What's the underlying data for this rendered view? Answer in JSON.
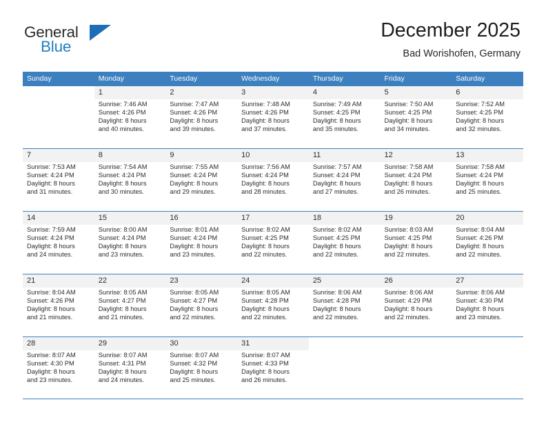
{
  "brand": {
    "name_part1": "General",
    "name_part2": "Blue",
    "logo_icon": "triangle-icon",
    "accent_color": "#1c6fb4"
  },
  "header": {
    "title": "December 2025",
    "subtitle": "Bad Worishofen, Germany"
  },
  "theme": {
    "header_row_color": "#3d80bf",
    "day_band_color": "#f2f2f2",
    "text_color": "#2b2b2b"
  },
  "weekday_headers": [
    "Sunday",
    "Monday",
    "Tuesday",
    "Wednesday",
    "Thursday",
    "Friday",
    "Saturday"
  ],
  "weeks": [
    [
      {
        "day": "",
        "info": "",
        "blank": true
      },
      {
        "day": "1",
        "info": "Sunrise: 7:46 AM\nSunset: 4:26 PM\nDaylight: 8 hours\nand 40 minutes."
      },
      {
        "day": "2",
        "info": "Sunrise: 7:47 AM\nSunset: 4:26 PM\nDaylight: 8 hours\nand 39 minutes."
      },
      {
        "day": "3",
        "info": "Sunrise: 7:48 AM\nSunset: 4:26 PM\nDaylight: 8 hours\nand 37 minutes."
      },
      {
        "day": "4",
        "info": "Sunrise: 7:49 AM\nSunset: 4:25 PM\nDaylight: 8 hours\nand 35 minutes."
      },
      {
        "day": "5",
        "info": "Sunrise: 7:50 AM\nSunset: 4:25 PM\nDaylight: 8 hours\nand 34 minutes."
      },
      {
        "day": "6",
        "info": "Sunrise: 7:52 AM\nSunset: 4:25 PM\nDaylight: 8 hours\nand 32 minutes."
      }
    ],
    [
      {
        "day": "7",
        "info": "Sunrise: 7:53 AM\nSunset: 4:24 PM\nDaylight: 8 hours\nand 31 minutes."
      },
      {
        "day": "8",
        "info": "Sunrise: 7:54 AM\nSunset: 4:24 PM\nDaylight: 8 hours\nand 30 minutes."
      },
      {
        "day": "9",
        "info": "Sunrise: 7:55 AM\nSunset: 4:24 PM\nDaylight: 8 hours\nand 29 minutes."
      },
      {
        "day": "10",
        "info": "Sunrise: 7:56 AM\nSunset: 4:24 PM\nDaylight: 8 hours\nand 28 minutes."
      },
      {
        "day": "11",
        "info": "Sunrise: 7:57 AM\nSunset: 4:24 PM\nDaylight: 8 hours\nand 27 minutes."
      },
      {
        "day": "12",
        "info": "Sunrise: 7:58 AM\nSunset: 4:24 PM\nDaylight: 8 hours\nand 26 minutes."
      },
      {
        "day": "13",
        "info": "Sunrise: 7:58 AM\nSunset: 4:24 PM\nDaylight: 8 hours\nand 25 minutes."
      }
    ],
    [
      {
        "day": "14",
        "info": "Sunrise: 7:59 AM\nSunset: 4:24 PM\nDaylight: 8 hours\nand 24 minutes."
      },
      {
        "day": "15",
        "info": "Sunrise: 8:00 AM\nSunset: 4:24 PM\nDaylight: 8 hours\nand 23 minutes."
      },
      {
        "day": "16",
        "info": "Sunrise: 8:01 AM\nSunset: 4:24 PM\nDaylight: 8 hours\nand 23 minutes."
      },
      {
        "day": "17",
        "info": "Sunrise: 8:02 AM\nSunset: 4:25 PM\nDaylight: 8 hours\nand 22 minutes."
      },
      {
        "day": "18",
        "info": "Sunrise: 8:02 AM\nSunset: 4:25 PM\nDaylight: 8 hours\nand 22 minutes."
      },
      {
        "day": "19",
        "info": "Sunrise: 8:03 AM\nSunset: 4:25 PM\nDaylight: 8 hours\nand 22 minutes."
      },
      {
        "day": "20",
        "info": "Sunrise: 8:04 AM\nSunset: 4:26 PM\nDaylight: 8 hours\nand 22 minutes."
      }
    ],
    [
      {
        "day": "21",
        "info": "Sunrise: 8:04 AM\nSunset: 4:26 PM\nDaylight: 8 hours\nand 21 minutes."
      },
      {
        "day": "22",
        "info": "Sunrise: 8:05 AM\nSunset: 4:27 PM\nDaylight: 8 hours\nand 21 minutes."
      },
      {
        "day": "23",
        "info": "Sunrise: 8:05 AM\nSunset: 4:27 PM\nDaylight: 8 hours\nand 22 minutes."
      },
      {
        "day": "24",
        "info": "Sunrise: 8:05 AM\nSunset: 4:28 PM\nDaylight: 8 hours\nand 22 minutes."
      },
      {
        "day": "25",
        "info": "Sunrise: 8:06 AM\nSunset: 4:28 PM\nDaylight: 8 hours\nand 22 minutes."
      },
      {
        "day": "26",
        "info": "Sunrise: 8:06 AM\nSunset: 4:29 PM\nDaylight: 8 hours\nand 22 minutes."
      },
      {
        "day": "27",
        "info": "Sunrise: 8:06 AM\nSunset: 4:30 PM\nDaylight: 8 hours\nand 23 minutes."
      }
    ],
    [
      {
        "day": "28",
        "info": "Sunrise: 8:07 AM\nSunset: 4:30 PM\nDaylight: 8 hours\nand 23 minutes."
      },
      {
        "day": "29",
        "info": "Sunrise: 8:07 AM\nSunset: 4:31 PM\nDaylight: 8 hours\nand 24 minutes."
      },
      {
        "day": "30",
        "info": "Sunrise: 8:07 AM\nSunset: 4:32 PM\nDaylight: 8 hours\nand 25 minutes."
      },
      {
        "day": "31",
        "info": "Sunrise: 8:07 AM\nSunset: 4:33 PM\nDaylight: 8 hours\nand 26 minutes."
      },
      {
        "day": "",
        "info": "",
        "blank": true
      },
      {
        "day": "",
        "info": "",
        "blank": true
      },
      {
        "day": "",
        "info": "",
        "blank": true
      }
    ]
  ]
}
